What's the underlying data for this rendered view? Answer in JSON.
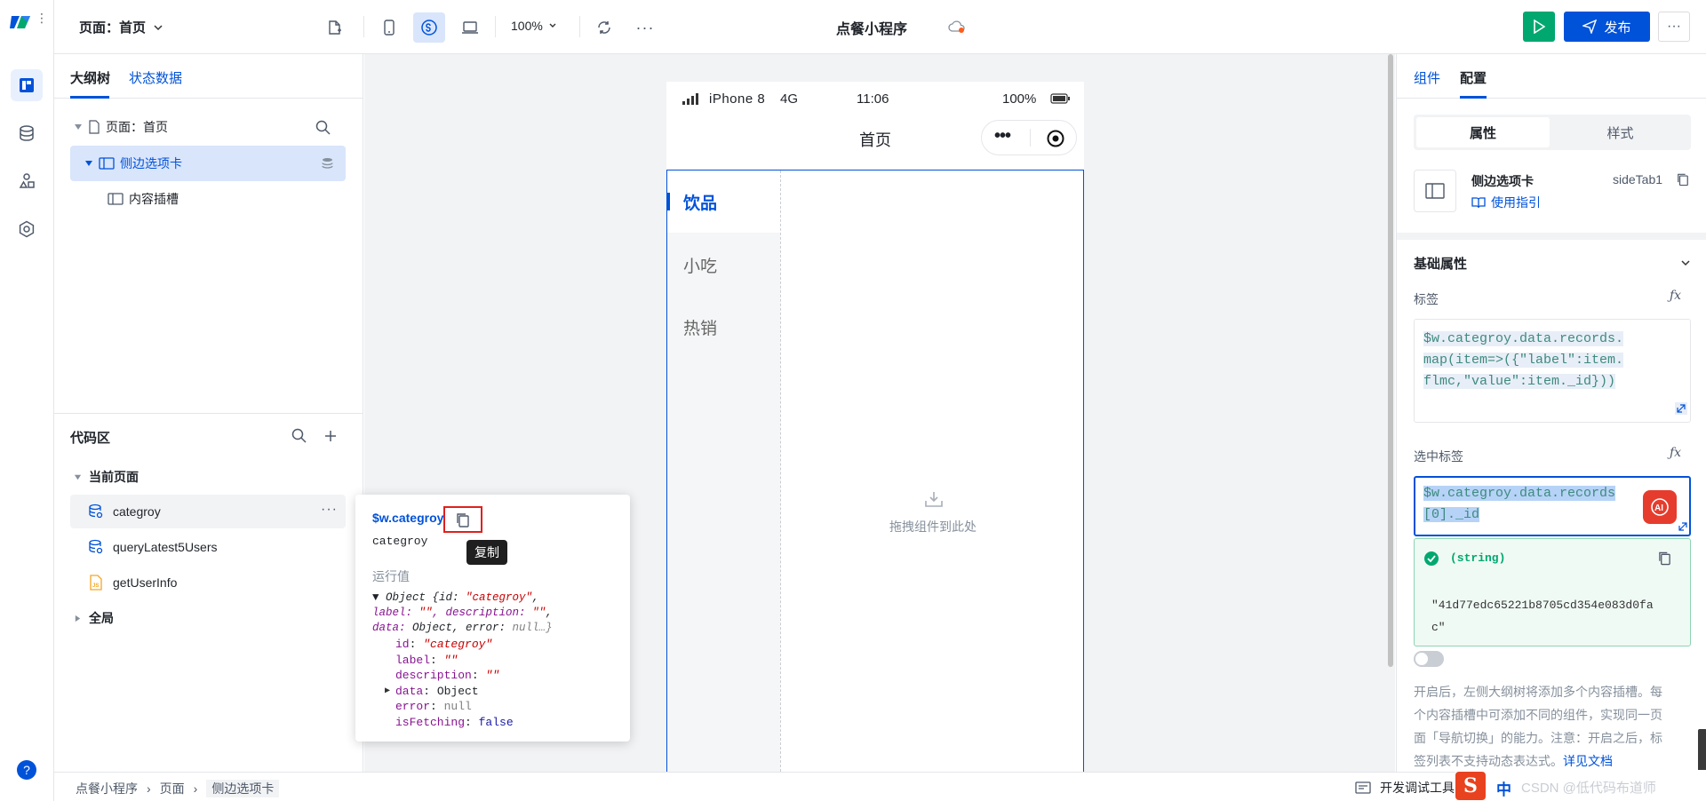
{
  "topbar": {
    "page_selector": "页面：首页",
    "zoom": "100%",
    "app_title": "点餐小程序",
    "publish_label": "发布"
  },
  "left_panel": {
    "tabs": [
      "大纲树",
      "状态数据"
    ],
    "tree": [
      {
        "label": "页面：首页"
      },
      {
        "label": "侧边选项卡"
      },
      {
        "label": "内容插槽"
      }
    ],
    "code_title": "代码区",
    "code_groups": [
      "当前页面",
      "全局"
    ],
    "code_items": [
      "categroy",
      "queryLatest5Users",
      "getUserInfo"
    ]
  },
  "phone": {
    "carrier": "iPhone 8",
    "network": "4G",
    "time": "11:06",
    "battery": "100%",
    "nav_title": "首页",
    "side_tabs": [
      "饮品",
      "小吃",
      "热销"
    ],
    "drop_hint": "拖拽组件到此处"
  },
  "popover": {
    "var_name": "$w.categroy",
    "name": "categroy",
    "copy_tooltip": "复制",
    "runtime_label": "运行值",
    "summary": {
      "line1_a": "▼ Object {id: ",
      "line1_b": "\"categroy\"",
      "line1_c": ",",
      "line2_a": "label: ",
      "line2_b": "\"\"",
      "line2_c": ", description: ",
      "line2_d": "\"\"",
      "line2_e": ",",
      "line3_a": "data: ",
      "line3_b": " Object, error: ",
      "line3_c": " null…}"
    },
    "fields": [
      {
        "k": "id",
        "v": "\"categroy\"",
        "t": "str"
      },
      {
        "k": "label",
        "v": "\"\"",
        "t": "str"
      },
      {
        "k": "description",
        "v": "\"\"",
        "t": "str"
      },
      {
        "k": "data",
        "v": "Object",
        "t": "obj"
      },
      {
        "k": "error",
        "v": "null",
        "t": "null"
      },
      {
        "k": "isFetching",
        "v": "false",
        "t": "bool"
      }
    ]
  },
  "right_panel": {
    "tabs": [
      "组件",
      "配置"
    ],
    "segments": [
      "属性",
      "样式"
    ],
    "component_name": "侧边选项卡",
    "component_id": "sideTab1",
    "guide_link": "使用指引",
    "section_title": "基础属性",
    "label_field": "标签",
    "label_expr": [
      "$w.categroy.data.records.",
      "map(item=>({\"label\":item.",
      "flmc,\"value\":item._id}))"
    ],
    "selected_field": "选中标签",
    "selected_expr": [
      "$w.categroy.data.records",
      "[0]._id"
    ],
    "result_type": "(string)",
    "result_value": [
      "\"41d77edc65221b8705cd354e083d0fa",
      "c\""
    ],
    "help_text": [
      "开启后，左侧大纲树将添加多个内容插槽。每",
      "个内容插槽中可添加不同的组件，实现同一页",
      "面「导航切换」的能力。注意：开启之后，标",
      "签列表不支持动态表达式。"
    ],
    "help_link": "详见文档"
  },
  "bottombar": {
    "breadcrumb": [
      "点餐小程序",
      "页面",
      "侧边选项卡"
    ],
    "devtools": "开发调试工具",
    "ime": "中",
    "watermark": "CSDN @低代码布道师"
  },
  "colors": {
    "primary": "#0052d9",
    "run": "#00a870",
    "selected": "#d9e5fb"
  }
}
